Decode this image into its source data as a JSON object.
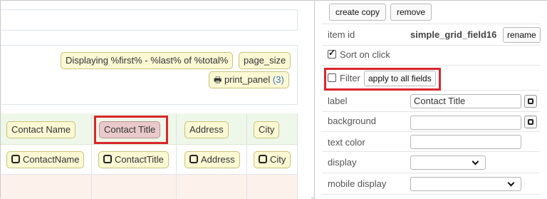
{
  "designer": {
    "toolbar": {
      "display_range": "Displaying %first% - %last% of %total%",
      "page_size": "page_size",
      "print_panel": "print_panel",
      "print_panel_count": "(3)"
    },
    "header_fields": [
      {
        "label": "Contact Name",
        "selected": false
      },
      {
        "label": "Contact Title",
        "selected": true
      },
      {
        "label": "Address",
        "selected": false
      },
      {
        "label": "City",
        "selected": false
      }
    ],
    "data_fields": [
      "ContactName",
      "ContactTitle",
      "Address",
      "City"
    ]
  },
  "properties": {
    "create_copy": "create copy",
    "remove": "remove",
    "item_id_label": "item id",
    "item_id_value": "simple_grid_field16",
    "rename": "rename",
    "sort_on_click": "Sort on click",
    "sort_on_click_checked": true,
    "filter": "Filter",
    "filter_checked": false,
    "apply_to_all": "apply to all fields",
    "label_label": "label",
    "label_value": "Contact Title",
    "background_label": "background",
    "background_value": "",
    "text_color_label": "text color",
    "text_color_value": "",
    "display_label": "display",
    "display_value": "",
    "mobile_display_label": "mobile display",
    "mobile_display_value": ""
  },
  "colors": {
    "highlight": "#d9262c",
    "chip_bg": "#fbf8d4",
    "chip_selected_bg": "#e9c9cb",
    "header_bg": "#eef7e9",
    "row_alt_bg": "#fdf1ec"
  }
}
